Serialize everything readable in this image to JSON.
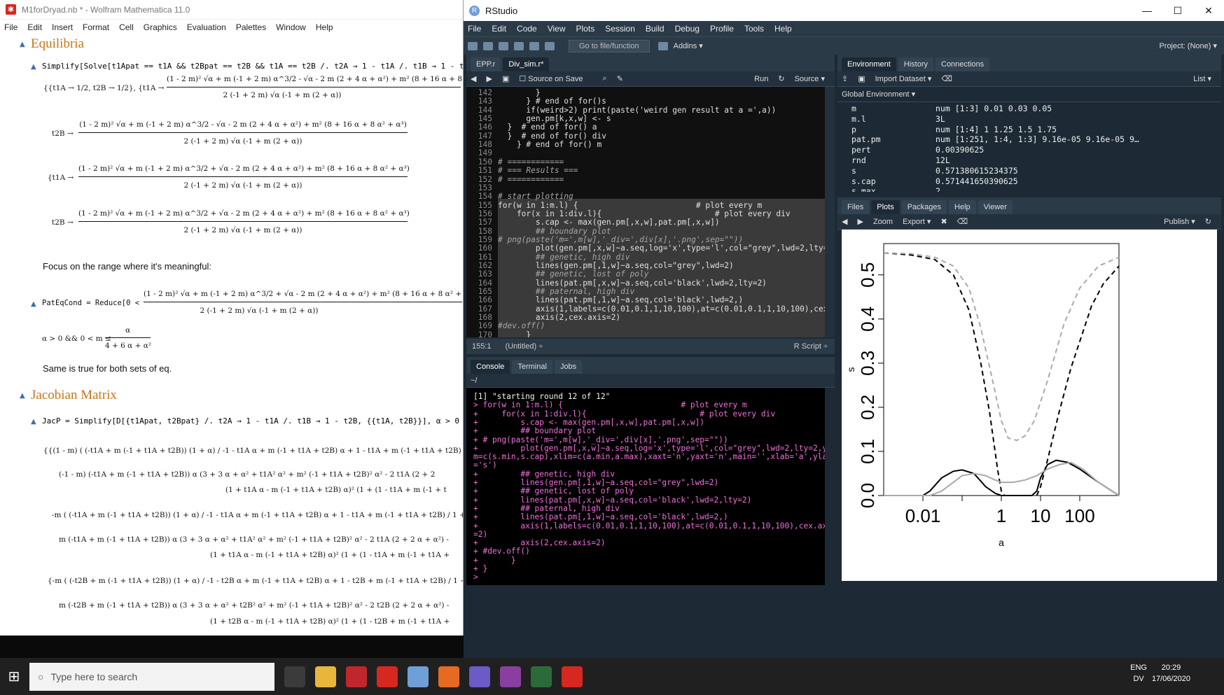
{
  "mathematica": {
    "title": "M1forDryad.nb * - Wolfram Mathematica 11.0",
    "menu": [
      "File",
      "Edit",
      "Insert",
      "Format",
      "Cell",
      "Graphics",
      "Evaluation",
      "Palettes",
      "Window",
      "Help"
    ],
    "section_equilibria": "Equilibria",
    "input_solve": "Simplify[Solve[t1Apat == t1A && t2Bpat == t2B && t1A == t2B /. t2A → 1 - t1A /. t1B → 1 - t2B, {t1A, t2",
    "sol_first": "{{t1A → 1/2, t2B → 1/2}, {t1A →",
    "num_a": "(1 - 2 m)² √α + m (-1 + 2 m) α^3/2 - √α - 2 m (2 + 4 α + α²) + m² (8 + 16 α + 8",
    "den_a": "2 (-1 + 2 m) √α  (-1 + m (2 + α))",
    "t2b_label": "t2B →",
    "num_b": "(1 - 2 m)² √α + m (-1 + 2 m) α^3/2 - √α - 2 m (2 + 4 α + α²) + m² (8 + 16 α + 8 α² + α³)",
    "den_b": "2 (-1 + 2 m) √α  (-1 + m (2 + α))",
    "t1a_label": "{t1A →",
    "num_c": "(1 - 2 m)² √α + m (-1 + 2 m) α^3/2 + √α - 2 m (2 + 4 α + α²) + m² (8 + 16 α + 8 α² + α³)",
    "num_d": "(1 - 2 m)² √α + m (-1 + 2 m) α^3/2 + √α - 2 m (2 + 4 α + α²) + m² (8 + 16 α + 8 α² + α³)",
    "focus_text": "Focus on the range where it's meaningful:",
    "pateq_label": "PatEqCond = Reduce[0 <",
    "pateq_num": "(1 - 2 m)² √α + m (-1 + 2 m) α^3/2 + √α - 2 m (2 + 4 α + α²) + m² (8 + 16 α + 8 α² + α",
    "pateq_den": "2 (-1 + 2 m) √α  (-1 + m (2 + α))",
    "cond_text": "α > 0 && 0 < m ≤",
    "cond_num": "α",
    "cond_den": "4 + 6 α + α²",
    "same_text": "Same is true for both sets of eq.",
    "section_jacobian": "Jacobian Matrix",
    "input_jac": "JacP = Simplify[D[{t1Apat, t2Bpat} /. t2A → 1 - t1A /. t1B → 1 - t2B, {{t1A, t2B}}], α > 0 && 0 < m",
    "jac_lines": [
      "{{(1 - m) ( (-t1A + m (-1 + t1A + t2B)) (1 + α)  /  -1 - t1A α + m (-1 + t1A + t2B) α   +   1 - t1A + m (-1 + t1A + t2B)  /  1 + (1 - t1A + m (-1 + t1A + t2B)) α ) +",
      "(-1 - m) (-t1A + m (-1 + t1A + t2B)) α (3 + 3 α + α² + t1A² α² + m² (-1 + t1A + t2B)² α² - 2 t1A (2 + 2",
      "(1 + t1A α - m (-1 + t1A + t2B) α)² (1 + (1 - t1A + m (-1 + t",
      "-m ( (-t1A + m (-1 + t1A + t2B)) (1 + α)  /  -1 - t1A α + m (-1 + t1A + t2B) α   +   1 - t1A + m (-1 + t1A + t2B)  /  1 + (1 - t1A + m (-1 + t1A + t2B)) α ) +",
      "m (-t1A + m (-1 + t1A + t2B)) α (3 + 3 α + α² + t1A² α² + m² (-1 + t1A + t2B)² α² - 2 t1A (2 + 2 α + α²) -",
      "(1 + t1A α - m (-1 + t1A + t2B) α)² (1 + (1 - t1A + m (-1 + t1A +",
      "{-m ( (-t2B + m (-1 + t1A + t2B)) (1 + α)  /  -1 - t2B α + m (-1 + t1A + t2B) α   +   1 - t2B + m (-1 + t1A + t2B)  /  1 + (1 - t2B + m (-1 + t1A + t2B)) α ) +",
      "m (-t2B + m (-1 + t1A + t2B)) α (3 + 3 α + α² + t2B² α² + m² (-1 + t1A + t2B)² α² - 2 t2B (2 + 2 α + α²) -",
      "(1 + t2B α - m (-1 + t1A + t2B) α)² (1 + (1 - t2B + m (-1 + t1A +"
    ]
  },
  "rstudio": {
    "title": "RStudio",
    "menu": [
      "File",
      "Edit",
      "Code",
      "View",
      "Plots",
      "Session",
      "Build",
      "Debug",
      "Profile",
      "Tools",
      "Help"
    ],
    "goto_placeholder": "Go to file/function",
    "addins": "Addins ▾",
    "project": "Project: (None) ▾",
    "editor_tabs": [
      "EPP.r",
      "Div_sim.r*"
    ],
    "source_on_save": "Source on Save",
    "run": "Run",
    "source": "Source ▾",
    "code_lines": [
      {
        "n": "142",
        "t": "        }"
      },
      {
        "n": "143",
        "t": "      } # end of for()s"
      },
      {
        "n": "144",
        "t": "      if(weird>2) print(paste('weird gen result at a =',a))"
      },
      {
        "n": "145",
        "t": "      gen.pm[k,x,w] <- s"
      },
      {
        "n": "146",
        "t": "  }  # end of for() a"
      },
      {
        "n": "147",
        "t": "  }  # end of for() div"
      },
      {
        "n": "148",
        "t": "    } # end of for() m"
      },
      {
        "n": "149",
        "t": ""
      },
      {
        "n": "150",
        "t": "# ============"
      },
      {
        "n": "151",
        "t": "# === Results ==="
      },
      {
        "n": "152",
        "t": "# ============"
      },
      {
        "n": "153",
        "t": ""
      },
      {
        "n": "154",
        "t": "# start plotting"
      },
      {
        "n": "155",
        "t": "for(w in 1:m.l) {                         # plot every m"
      },
      {
        "n": "156",
        "t": "    for(x in 1:div.l){                        # plot every div"
      },
      {
        "n": "157",
        "t": "        s.cap <- max(gen.pm[,x,w],pat.pm[,x,w])"
      },
      {
        "n": "158",
        "t": "        ## boundary plot"
      },
      {
        "n": "159",
        "t": "# png(paste('m=',m[w],'_div=',div[x],'.png',sep=\"\"))"
      },
      {
        "n": "160",
        "t": "        plot(gen.pm[,x,w]~a.seq,log='x',type='l',col=\"grey\",lwd=2,lty=2"
      },
      {
        "n": "161",
        "t": "        ## genetic, high div"
      },
      {
        "n": "162",
        "t": "        lines(gen.pm[,1,w]~a.seq,col=\"grey\",lwd=2)"
      },
      {
        "n": "163",
        "t": "        ## genetic, lost of poly"
      },
      {
        "n": "164",
        "t": "        lines(pat.pm[,x,w]~a.seq,col='black',lwd=2,lty=2)"
      },
      {
        "n": "165",
        "t": "        ## paternal, high div"
      },
      {
        "n": "166",
        "t": "        lines(pat.pm[,1,w]~a.seq,col='black',lwd=2,)"
      },
      {
        "n": "167",
        "t": "        axis(1,labels=c(0.01,0.1,1,10,100),at=c(0.01,0.1,1,10,100),cex."
      },
      {
        "n": "168",
        "t": "        axis(2,cex.axis=2)"
      },
      {
        "n": "169",
        "t": "#dev.off()"
      },
      {
        "n": "170",
        "t": "      }"
      },
      {
        "n": "171",
        "t": "}"
      },
      {
        "n": "172",
        "t": ""
      }
    ],
    "cursor_pos": "155:1",
    "scope": "(Untitled) ÷",
    "file_type": "R Script ÷",
    "console_tabs": [
      "Console",
      "Terminal",
      "Jobs"
    ],
    "console_path": "~/",
    "console_lines": [
      {
        "t": "[1] \"starting round 12 of 12\"",
        "out": true
      },
      {
        "t": "> for(w in 1:m.l) {                         # plot every m",
        "out": false
      },
      {
        "t": "+     for(x in 1:div.l){                        # plot every div",
        "out": false
      },
      {
        "t": "+         s.cap <- max(gen.pm[,x,w],pat.pm[,x,w])",
        "out": false
      },
      {
        "t": "+         ## boundary plot",
        "out": false
      },
      {
        "t": "+ # png(paste('m=',m[w],'_div=',div[x],'.png',sep=\"\"))",
        "out": false
      },
      {
        "t": "+         plot(gen.pm[,x,w]~a.seq,log='x',type='l',col=\"grey\",lwd=2,lty=2,yli",
        "out": false
      },
      {
        "t": "m=c(s.min,s.cap),xlim=c(a.min,a.max),xaxt='n',yaxt='n',main='',xlab='a',ylab",
        "out": false
      },
      {
        "t": "='s')",
        "out": false
      },
      {
        "t": "+         ## genetic, high div",
        "out": false
      },
      {
        "t": "+         lines(gen.pm[,1,w]~a.seq,col=\"grey\",lwd=2)",
        "out": false
      },
      {
        "t": "+         ## genetic, lost of poly",
        "out": false
      },
      {
        "t": "+         lines(pat.pm[,x,w]~a.seq,col='black',lwd=2,lty=2)",
        "out": false
      },
      {
        "t": "+         ## paternal, high div",
        "out": false
      },
      {
        "t": "+         lines(pat.pm[,1,w]~a.seq,col='black',lwd=2,)",
        "out": false
      },
      {
        "t": "+         axis(1,labels=c(0.01,0.1,1,10,100),at=c(0.01,0.1,1,10,100),cex.axis",
        "out": false
      },
      {
        "t": "=2)",
        "out": false
      },
      {
        "t": "+         axis(2,cex.axis=2)",
        "out": false
      },
      {
        "t": "+ #dev.off()",
        "out": false
      },
      {
        "t": "+       }",
        "out": false
      },
      {
        "t": "+ }",
        "out": false
      },
      {
        "t": ">",
        "out": false
      }
    ],
    "env_tabs": [
      "Environment",
      "History",
      "Connections"
    ],
    "import_dataset": "Import Dataset ▾",
    "list_view": "List ▾",
    "global_env": "Global Environment ▾",
    "env_rows": [
      {
        "k": "m",
        "v": "num [1:3] 0.01 0.03 0.05"
      },
      {
        "k": "m.l",
        "v": "3L"
      },
      {
        "k": "p",
        "v": "num [1:4] 1 1.25 1.5 1.75"
      },
      {
        "k": "pat.pm",
        "v": "num [1:251, 1:4, 1:3] 9.16e-05 9.16e-05 9…"
      },
      {
        "k": "pert",
        "v": "0.00390625"
      },
      {
        "k": "rnd",
        "v": "12L"
      },
      {
        "k": "s",
        "v": "0.571380615234375"
      },
      {
        "k": "s.cap",
        "v": "0.571441650390625"
      },
      {
        "k": "s.max",
        "v": "2"
      },
      {
        "k": "s.min",
        "v": "0"
      }
    ],
    "files_tabs": [
      "Files",
      "Plots",
      "Packages",
      "Help",
      "Viewer"
    ],
    "zoom": "Zoom",
    "export": "Export ▾",
    "publish": "Publish ▾"
  },
  "chart_data": {
    "type": "line",
    "xlabel": "a",
    "ylabel": "s",
    "x_scale": "log",
    "xlim": [
      0.001,
      1000
    ],
    "ylim": [
      0,
      0.571
    ],
    "x_ticks": [
      0.01,
      0.1,
      1,
      10,
      100
    ],
    "x_tick_labels": [
      "0.01",
      "",
      "1",
      "10",
      "100"
    ],
    "y_ticks": [
      0,
      0.1,
      0.2,
      0.3,
      0.4,
      0.5
    ],
    "y_tick_labels": [
      "0.0",
      "0.1",
      "0.2",
      "0.3",
      "0.4",
      "0.5"
    ],
    "series": [
      {
        "color": "#000000",
        "dash": true,
        "x": [
          0.001,
          0.005,
          0.02,
          0.06,
          0.15,
          0.3,
          0.5,
          0.8,
          1.0,
          1.2,
          1.5
        ],
        "y": [
          0.55,
          0.545,
          0.535,
          0.5,
          0.42,
          0.3,
          0.19,
          0.06,
          0.01,
          0.0,
          0.0
        ]
      },
      {
        "color": "#000000",
        "dash": true,
        "x": [
          8,
          10,
          15,
          30,
          60,
          120,
          200,
          400,
          1000
        ],
        "y": [
          0.0,
          0.02,
          0.08,
          0.19,
          0.29,
          0.37,
          0.43,
          0.48,
          0.52
        ]
      },
      {
        "color": "#aaaaaa",
        "dash": true,
        "x": [
          0.001,
          0.005,
          0.02,
          0.06,
          0.15,
          0.3,
          0.6,
          1.0,
          1.5,
          2.5,
          4,
          7,
          15,
          40,
          100,
          300,
          1000
        ],
        "y": [
          0.55,
          0.548,
          0.54,
          0.52,
          0.47,
          0.38,
          0.26,
          0.17,
          0.13,
          0.125,
          0.135,
          0.17,
          0.26,
          0.39,
          0.47,
          0.52,
          0.54
        ]
      },
      {
        "color": "#000000",
        "dash": false,
        "x": [
          0.001,
          0.01,
          0.015,
          0.03,
          0.06,
          0.1,
          0.2,
          0.4,
          0.7,
          1.0,
          1.5,
          3,
          6,
          8,
          10,
          15,
          25,
          50,
          100,
          300,
          1000
        ],
        "y": [
          0.0,
          0.0,
          0.01,
          0.04,
          0.055,
          0.058,
          0.05,
          0.02,
          0.005,
          0.0,
          0.0,
          0.0,
          0.0,
          0.01,
          0.04,
          0.07,
          0.08,
          0.075,
          0.06,
          0.03,
          0.0
        ]
      },
      {
        "color": "#aaaaaa",
        "dash": false,
        "x": [
          0.001,
          0.015,
          0.03,
          0.06,
          0.1,
          0.2,
          0.4,
          0.7,
          1.0,
          2,
          4,
          8,
          15,
          30,
          60,
          120,
          300,
          1000
        ],
        "y": [
          0.0,
          0.0,
          0.01,
          0.03,
          0.045,
          0.05,
          0.045,
          0.035,
          0.03,
          0.03,
          0.035,
          0.045,
          0.06,
          0.07,
          0.075,
          0.06,
          0.03,
          0.0
        ]
      }
    ]
  },
  "taskbar": {
    "search_placeholder": "Type here to search",
    "lang_top": "ENG",
    "lang_bottom": "DV",
    "time": "20:29",
    "date": "17/06/2020"
  }
}
